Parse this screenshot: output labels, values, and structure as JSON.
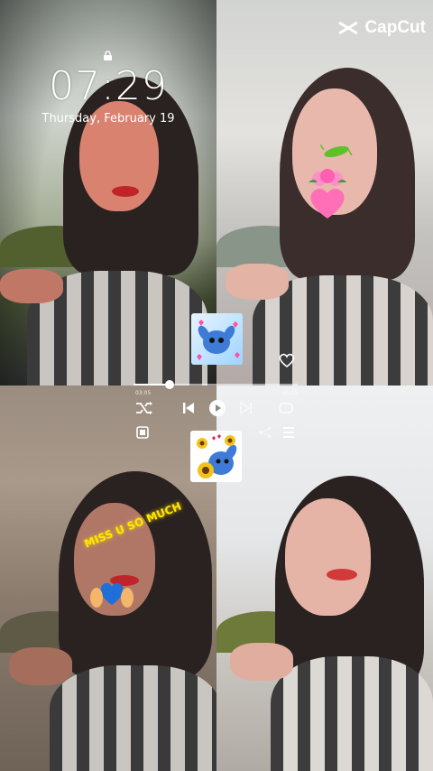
{
  "lockscreen": {
    "time": "07:29",
    "date": "Thursday, February 19"
  },
  "watermark": {
    "brand": "CapCut"
  },
  "player": {
    "elapsed": "03:05",
    "total": "05:05",
    "progress": 0.22
  },
  "stickers": {
    "text_overlay": "MISS U SO MUCH",
    "icons": [
      "stitch-heart-sticker",
      "stitch-sunflower-sticker",
      "rose-heart-sticker",
      "blue-heart-hands-sticker",
      "heart-outline-icon"
    ]
  },
  "colors": {
    "accent_text": "#ffe600",
    "ui_white": "#ffffff"
  }
}
